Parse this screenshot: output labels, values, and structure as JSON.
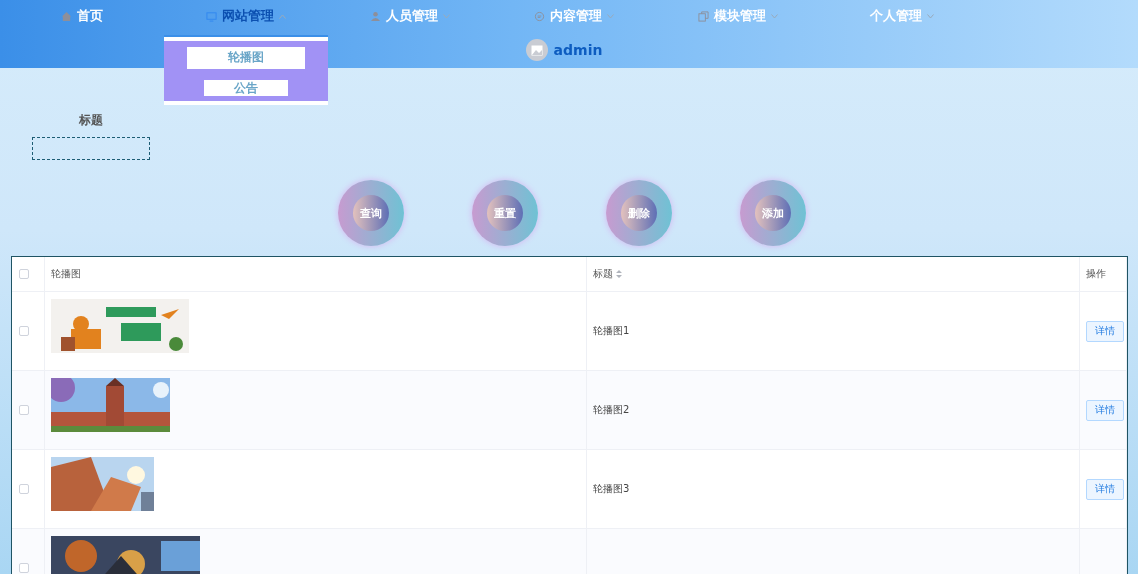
{
  "nav": {
    "items": [
      {
        "label": "首页",
        "selected": false
      },
      {
        "label": "网站管理",
        "selected": true,
        "expanded": true,
        "menu": [
          "轮播图",
          "公告"
        ]
      },
      {
        "label": "人员管理",
        "selected": false,
        "expanded": false
      },
      {
        "label": "内容管理",
        "selected": false,
        "expanded": false
      },
      {
        "label": "模块管理",
        "selected": false,
        "expanded": false
      },
      {
        "label": "个人管理",
        "selected": false,
        "expanded": false
      }
    ],
    "user": {
      "name": "admin"
    }
  },
  "search": {
    "label": "标题"
  },
  "buttons": [
    "查询",
    "重置",
    "删除",
    "添加"
  ],
  "table": {
    "select_all": {
      "checked": false
    },
    "columns": [
      {
        "label": "轮播图",
        "sortable": false
      },
      {
        "label": "标题",
        "sortable": true
      },
      {
        "label": "操作",
        "sortable": false
      }
    ],
    "rows": [
      {
        "checked": false,
        "title": "轮播图1",
        "action": "详情"
      },
      {
        "checked": false,
        "title": "轮播图2",
        "action": "详情"
      },
      {
        "checked": false,
        "title": "轮播图3",
        "action": "详情"
      },
      {
        "checked": false
      }
    ]
  }
}
